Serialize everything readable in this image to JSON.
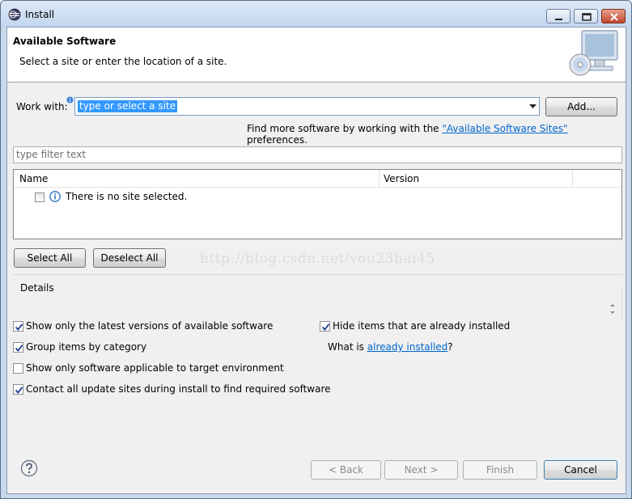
{
  "window": {
    "title": "Install"
  },
  "banner": {
    "title": "Available Software",
    "description": "Select a site or enter the location of a site."
  },
  "work_with": {
    "label": "Work with:",
    "value": "type or select a site",
    "add_button": "Add..."
  },
  "find_more": {
    "prefix": "Find more software by working with the ",
    "link": "\"Available Software Sites\"",
    "suffix": " preferences."
  },
  "filter": {
    "placeholder": "type filter text"
  },
  "tree": {
    "columns": [
      "Name",
      "Version"
    ],
    "rows": [
      {
        "text": "There is no site selected.",
        "checked": false
      }
    ]
  },
  "buttons": {
    "select_all": "Select All",
    "deselect_all": "Deselect All",
    "back": "< Back",
    "next": "Next >",
    "finish": "Finish",
    "cancel": "Cancel"
  },
  "watermark": "http://blog.csdn.net/you23hai45",
  "details": {
    "label": "Details"
  },
  "options": {
    "latest_versions": {
      "label": "Show only the latest versions of available software",
      "checked": true
    },
    "group_by_category": {
      "label": "Group items by category",
      "checked": true
    },
    "target_env": {
      "label": "Show only software applicable to target environment",
      "checked": false
    },
    "contact_sites": {
      "label": "Contact all update sites during install to find required software",
      "checked": true
    },
    "hide_installed": {
      "label": "Hide items that are already installed",
      "checked": true
    }
  },
  "what_is": {
    "prefix": "What is ",
    "link": "already installed",
    "suffix": "?"
  },
  "colors": {
    "selection": "#3399ff",
    "link": "#0066cc"
  }
}
